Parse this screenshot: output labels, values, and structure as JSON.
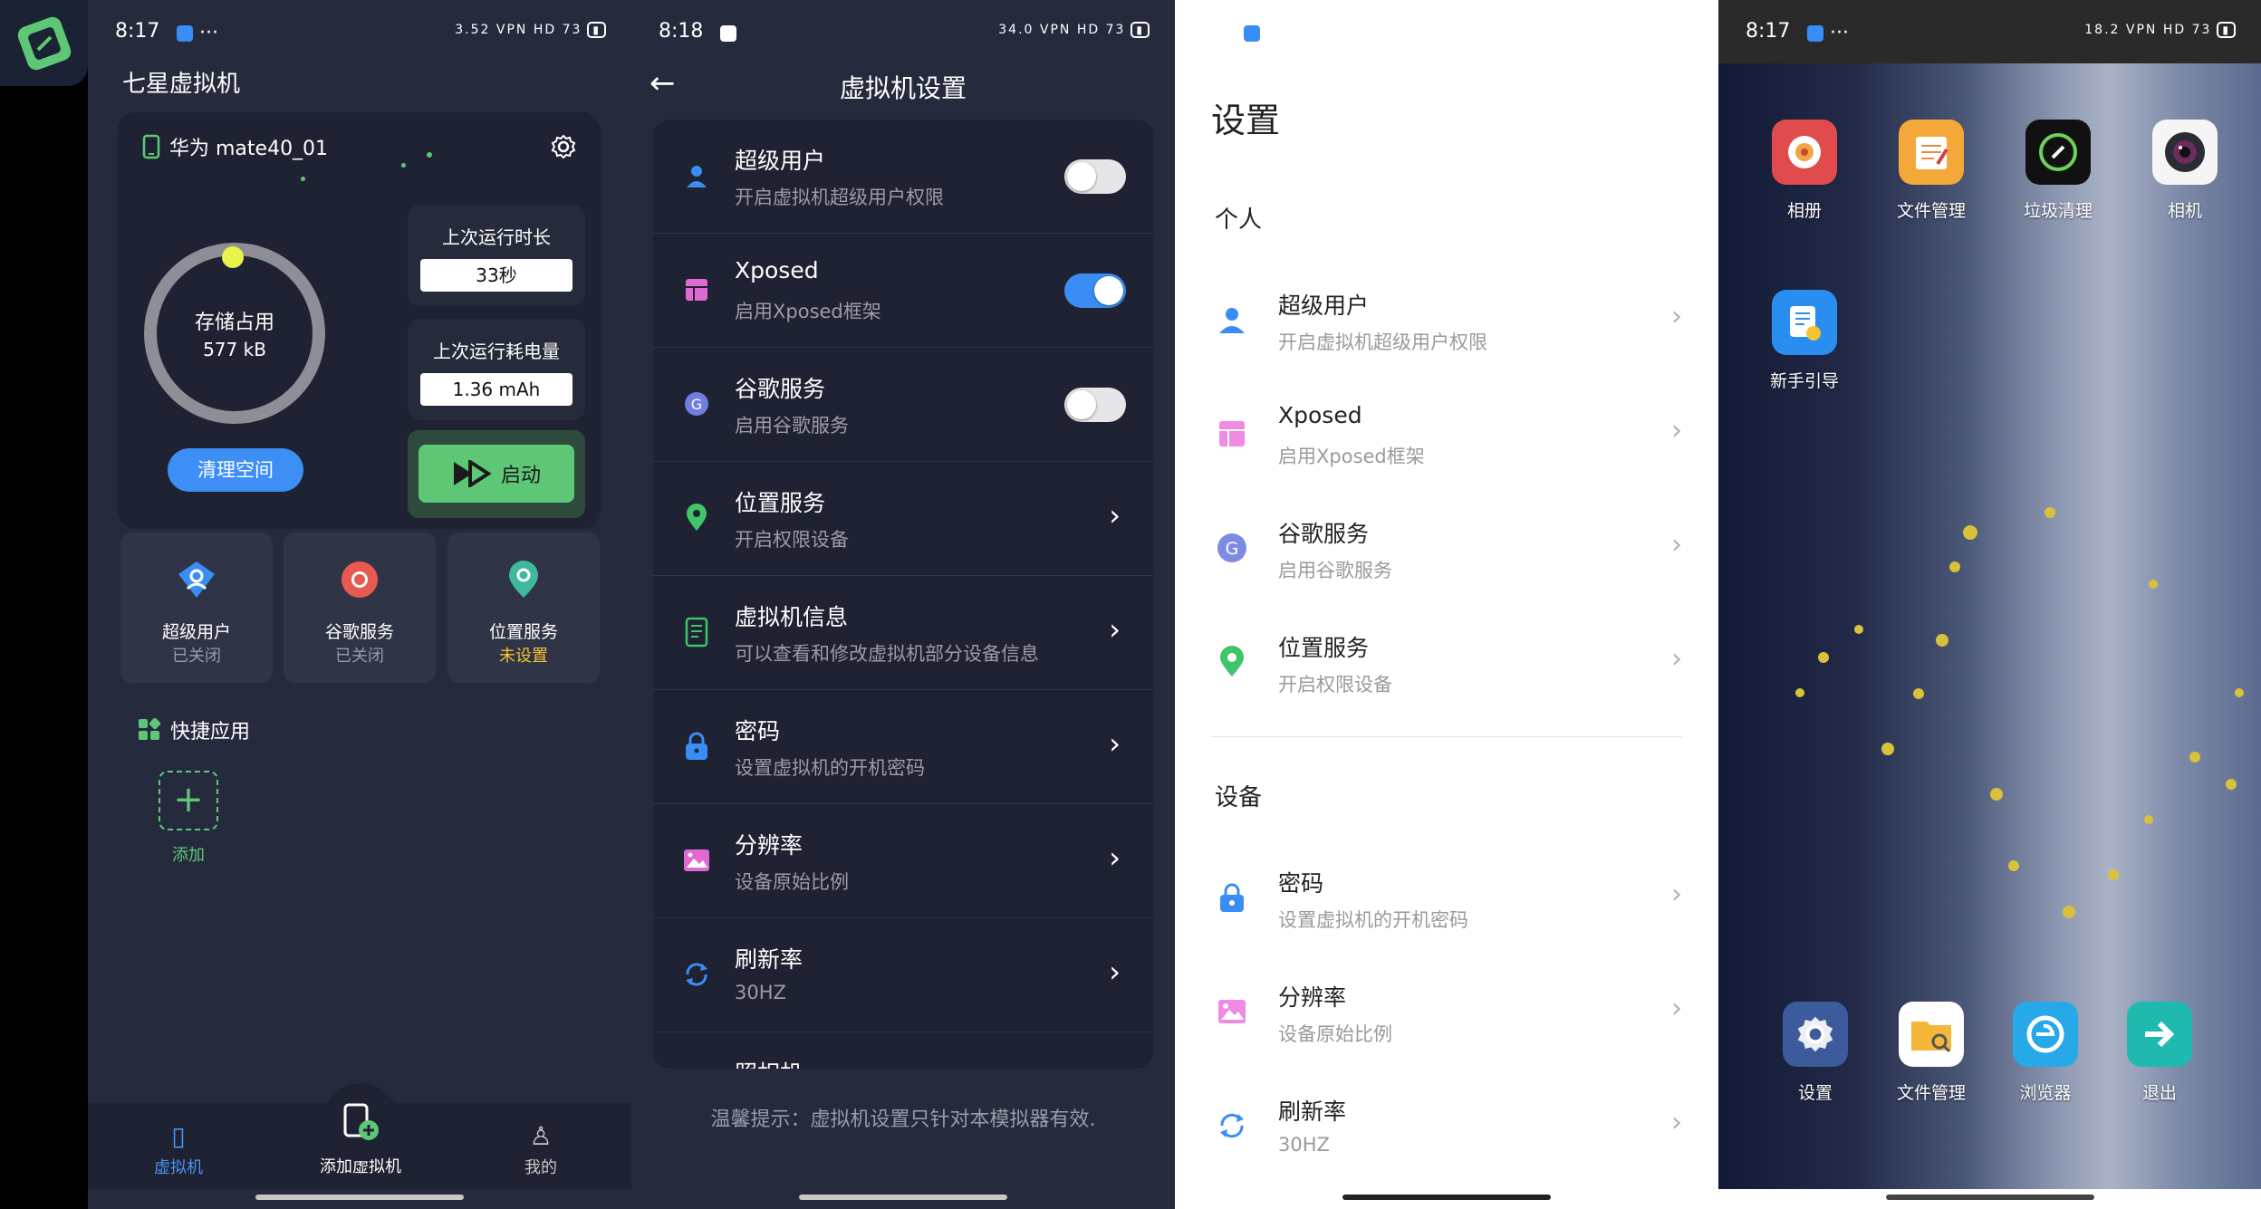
{
  "panel1": {
    "status": {
      "time": "8:17",
      "icons": "3.52 VPN HD 73"
    },
    "app_title": "七星虚拟机",
    "device_name": "华为 mate40_01",
    "storage_label": "存储占用",
    "storage_value": "577 kB",
    "clear_button": "清理空间",
    "last_runtime_label": "上次运行时长",
    "last_runtime_value": "33秒",
    "last_power_label": "上次运行耗电量",
    "last_power_value": "1.36 mAh",
    "start_button": "启动",
    "quick_cards": [
      {
        "title": "超级用户",
        "status": "已关闭"
      },
      {
        "title": "谷歌服务",
        "status": "已关闭"
      },
      {
        "title": "位置服务",
        "status": "未设置"
      }
    ],
    "quick_apps_title": "快捷应用",
    "add_label": "添加",
    "nav": [
      {
        "label": "虚拟机"
      },
      {
        "label": "添加虚拟机"
      },
      {
        "label": "我的"
      }
    ]
  },
  "panel2": {
    "status": {
      "time": "8:18",
      "icons": "34.0 VPN HD 73"
    },
    "title": "虚拟机设置",
    "rows": [
      {
        "title": "超级用户",
        "subtitle": "开启虚拟机超级用户权限"
      },
      {
        "title": "Xposed",
        "subtitle": "启用Xposed框架"
      },
      {
        "title": "谷歌服务",
        "subtitle": "启用谷歌服务"
      },
      {
        "title": "位置服务",
        "subtitle": "开启权限设备"
      },
      {
        "title": "虚拟机信息",
        "subtitle": "可以查看和修改虚拟机部分设备信息"
      },
      {
        "title": "密码",
        "subtitle": "设置虚拟机的开机密码"
      },
      {
        "title": "分辨率",
        "subtitle": "设备原始比例"
      },
      {
        "title": "刷新率",
        "subtitle": "30HZ"
      },
      {
        "title": "照相机",
        "subtitle": ""
      }
    ],
    "toggles": {
      "superuser": false,
      "xposed": true,
      "google": false
    },
    "tip": "温馨提示：虚拟机设置只针对本模拟器有效."
  },
  "panel3": {
    "title": "设置",
    "section_personal": "个人",
    "section_device": "设备",
    "rows": [
      {
        "title": "超级用户",
        "subtitle": "开启虚拟机超级用户权限"
      },
      {
        "title": "Xposed",
        "subtitle": "启用Xposed框架"
      },
      {
        "title": "谷歌服务",
        "subtitle": "启用谷歌服务"
      },
      {
        "title": "位置服务",
        "subtitle": "开启权限设备"
      },
      {
        "title": "密码",
        "subtitle": "设置虚拟机的开机密码"
      },
      {
        "title": "分辨率",
        "subtitle": "设备原始比例"
      },
      {
        "title": "刷新率",
        "subtitle": "30HZ"
      }
    ]
  },
  "panel4": {
    "status": {
      "time": "8:17",
      "icons": "18.2 VPN HD 73"
    },
    "apps_top": [
      {
        "label": "相册"
      },
      {
        "label": "文件管理"
      },
      {
        "label": "垃圾清理"
      },
      {
        "label": "相机"
      },
      {
        "label": "新手引导"
      }
    ],
    "apps_dock": [
      {
        "label": "设置"
      },
      {
        "label": "文件管理"
      },
      {
        "label": "浏览器"
      },
      {
        "label": "退出"
      }
    ]
  },
  "colors": {
    "accent": "#3a8df5",
    "green": "#5ec776",
    "dark_bg": "#262a3d",
    "card_bg": "#1e2232",
    "warn": "#f4c430"
  }
}
